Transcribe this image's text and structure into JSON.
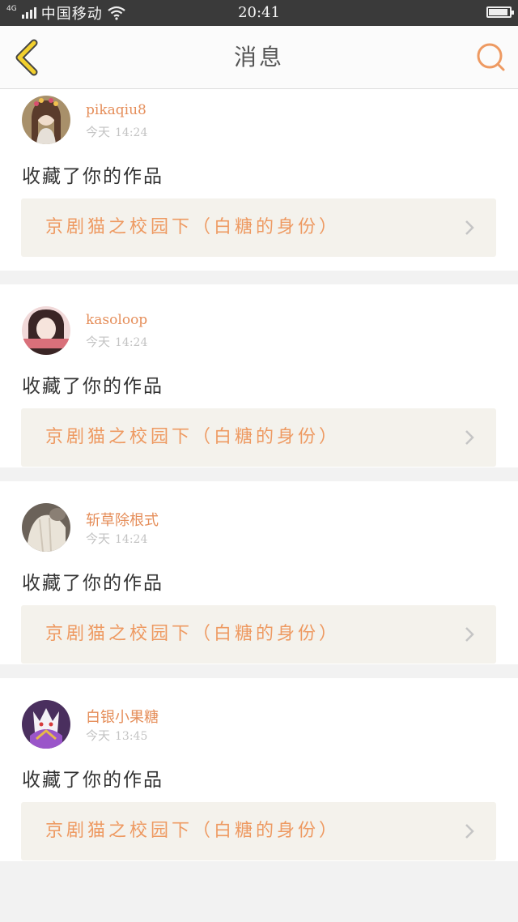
{
  "status_bar": {
    "network": "4G",
    "carrier": "中国移动",
    "time": "20:41",
    "battery_level": 0.9
  },
  "header": {
    "title": "消息",
    "back_icon": "chevron-left-icon",
    "search_icon": "search-icon"
  },
  "colors": {
    "accent": "#ee9a62",
    "username": "#e58e5a",
    "back_icon": "#f2d02e",
    "card_bg": "#f4f2ec"
  },
  "messages": [
    {
      "username": "pikaqiu8",
      "day": "今天",
      "time": "14:24",
      "action": "收藏了你的作品",
      "work_title": "京剧猫之校园下（白糖的身份）"
    },
    {
      "username": "kasoloop",
      "day": "今天",
      "time": "14:24",
      "action": "收藏了你的作品",
      "work_title": "京剧猫之校园下（白糖的身份）"
    },
    {
      "username": "斩草除根式",
      "day": "今天",
      "time": "14:24",
      "action": "收藏了你的作品",
      "work_title": "京剧猫之校园下（白糖的身份）"
    },
    {
      "username": "白银小果糖",
      "day": "今天",
      "time": "13:45",
      "action": "收藏了你的作品",
      "work_title": "京剧猫之校园下（白糖的身份）"
    }
  ]
}
